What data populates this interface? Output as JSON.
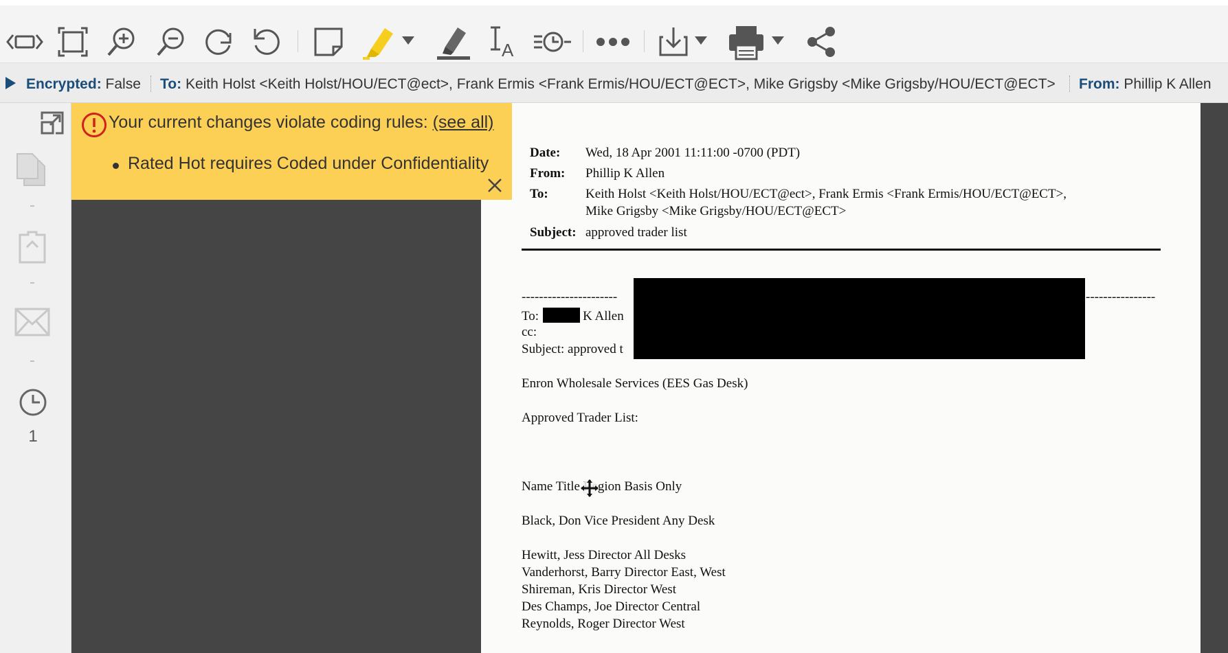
{
  "toolbar": {
    "tools": [
      {
        "name": "fit-width-icon"
      },
      {
        "name": "fit-page-icon"
      },
      {
        "name": "zoom-in-icon"
      },
      {
        "name": "zoom-out-icon"
      },
      {
        "name": "rotate-clockwise-icon"
      },
      {
        "name": "rotate-counterclockwise-icon"
      },
      {
        "name": "sticky-note-icon"
      },
      {
        "name": "highlighter-icon",
        "color": "#f6cf1e"
      },
      {
        "name": "redaction-marker-icon"
      },
      {
        "name": "text-annotation-icon"
      },
      {
        "name": "history-icon"
      },
      {
        "name": "more-icon"
      },
      {
        "name": "download-icon"
      },
      {
        "name": "print-icon"
      },
      {
        "name": "share-icon"
      }
    ]
  },
  "metabar": {
    "expand_icon": "play-triangle-icon",
    "encrypted_label": "Encrypted:",
    "encrypted_value": "False",
    "to_label": "To:",
    "to_value": "Keith Holst <Keith Holst/HOU/ECT@ect>, Frank Ermis <Frank Ermis/HOU/ECT@ECT>, Mike Grigsby <Mike Grigsby/HOU/ECT@ECT>",
    "from_label": "From:",
    "from_value": "Phillip K Allen"
  },
  "rail": {
    "items": [
      {
        "icon": "expand-icon"
      },
      {
        "icon": "copies-icon"
      },
      {
        "icon": "attachments-icon"
      },
      {
        "icon": "email-icon"
      },
      {
        "icon": "history-clock-icon",
        "count": "1"
      }
    ]
  },
  "warning": {
    "message": "Your current changes violate coding rules: ",
    "link": "(see all)",
    "rule": "Rated Hot requires Coded under Confidentiality",
    "color": "#fccf55"
  },
  "document": {
    "date_label": "Date:",
    "date_value": "Wed, 18 Apr 2001 11:11:00 -0700 (PDT)",
    "from_label": "From:",
    "from_value": "Phillip K Allen",
    "to_label": "To:",
    "to_value_line1": "Keith Holst <Keith Holst/HOU/ECT@ect>, Frank Ermis <Frank Ermis/HOU/ECT@ECT>,",
    "to_value_line2": "Mike Grigsby <Mike Grigsby/HOU/ECT@ECT>",
    "subject_label": "Subject:",
    "subject_value": "approved trader list",
    "fwd_dashes_left": "----------------------",
    "fwd_dashes_right": "----------------",
    "fwd_to_prefix": "To:",
    "fwd_to_suffix": "K Allen",
    "fwd_cc": "cc:",
    "fwd_subject": "Subject: approved t",
    "body": [
      "Enron Wholesale Services (EES Gas Desk)",
      "Approved Trader List:",
      "Name Title Region Basis Only",
      "Black, Don Vice President Any Desk",
      "Hewitt, Jess Director All Desks",
      "Vanderhorst, Barry Director East, West",
      "Shireman, Kris Director West",
      "Des Champs, Joe Director Central",
      "Reynolds, Roger Director West"
    ]
  }
}
